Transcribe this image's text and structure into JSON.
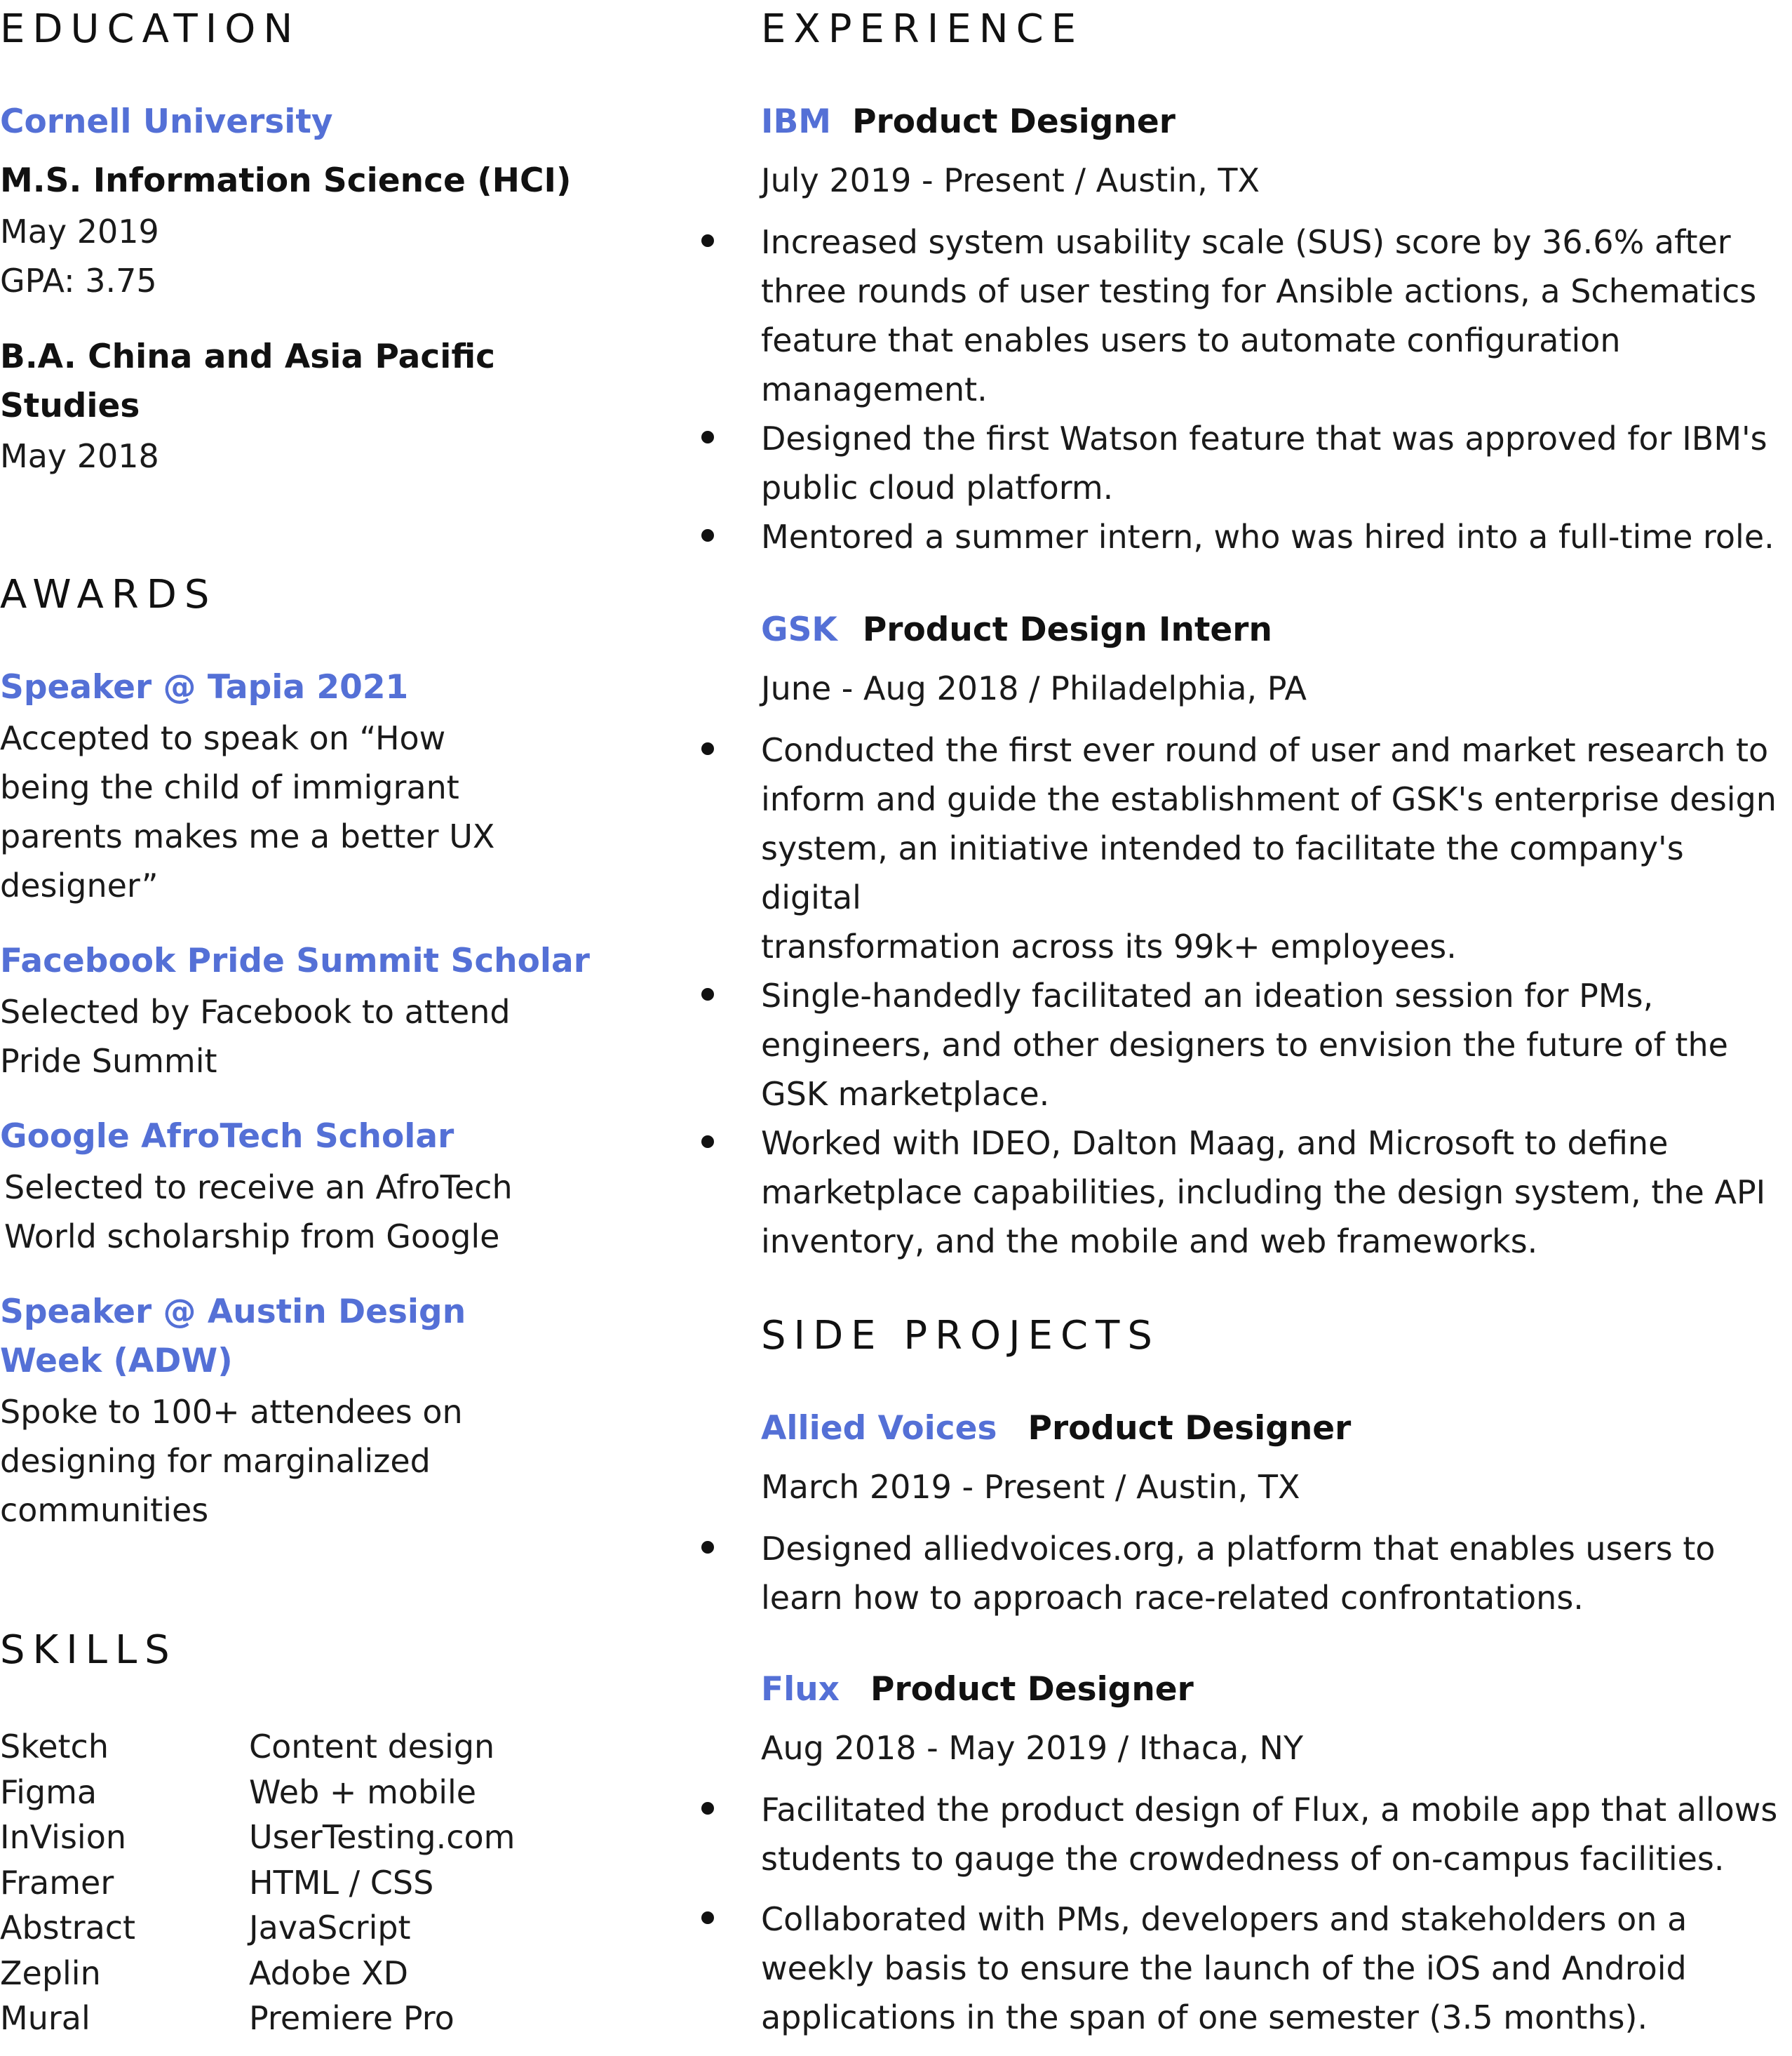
{
  "education": {
    "heading": "EDUCATION",
    "school": "Cornell University",
    "degrees": [
      {
        "title": "M.S. Information Science (HCI)",
        "lines": [
          "May 2019",
          "GPA: 3.75"
        ]
      },
      {
        "title_lines": [
          "B.A. China and Asia Pacific",
          "Studies"
        ],
        "lines": [
          "May 2018"
        ]
      }
    ]
  },
  "awards": {
    "heading": "AWARDS",
    "items": [
      {
        "title_lines": [
          "Speaker @ Tapia 2021"
        ],
        "desc_lines": [
          "Accepted to speak on “How",
          "being the child of immigrant",
          "parents makes me a better UX",
          "designer”"
        ]
      },
      {
        "title_lines": [
          "Facebook Pride Summit Scholar"
        ],
        "desc_lines": [
          "Selected by Facebook to attend",
          "Pride Summit"
        ]
      },
      {
        "title_lines": [
          "Google AfroTech Scholar"
        ],
        "desc_lines": [
          "Selected to receive an AfroTech",
          "World scholarship from Google"
        ]
      },
      {
        "title_lines": [
          "Speaker @ Austin Design",
          "Week (ADW)"
        ],
        "desc_lines": [
          "Spoke to 100+ attendees on",
          "designing for marginalized",
          "communities"
        ]
      }
    ]
  },
  "skills": {
    "heading": "SKILLS",
    "col1": [
      "Sketch",
      "Figma",
      "InVision",
      "Framer",
      "Abstract",
      "Zeplin",
      "Mural"
    ],
    "col2": [
      "Content design",
      "Web + mobile",
      "UserTesting.com",
      "HTML / CSS",
      "JavaScript",
      "Adobe XD",
      "Premiere Pro"
    ]
  },
  "experience": {
    "heading": "EXPERIENCE",
    "jobs": [
      {
        "company": "IBM",
        "role": "Product Designer",
        "meta": "July 2019 - Present / Austin, TX",
        "bullets": [
          [
            "Increased system usability scale (SUS) score by 36.6% after",
            "three rounds of user testing for Ansible actions, a Schematics",
            "feature that enables users to automate configuration",
            "management."
          ],
          [
            "Designed the first Watson feature that was approved for IBM's",
            "public cloud platform."
          ],
          [
            "Mentored a summer intern, who was hired into a full-time role."
          ]
        ]
      },
      {
        "company": "GSK",
        "role": "Product Design Intern",
        "meta": "June - Aug 2018 / Philadelphia, PA",
        "bullets": [
          [
            "Conducted the first ever round of user and market research to",
            "inform and guide the establishment of GSK's enterprise design",
            "system, an initiative intended to facilitate the company's digital",
            "transformation across its 99k+ employees."
          ],
          [
            "Single-handedly facilitated an ideation session for PMs,",
            "engineers, and other designers to envision the future of the",
            "GSK marketplace."
          ],
          [
            "Worked with IDEO, Dalton Maag, and Microsoft to define",
            "marketplace capabilities, including the design system, the API",
            "inventory, and the mobile and web frameworks."
          ]
        ]
      }
    ]
  },
  "side_projects": {
    "heading": "SIDE PROJECTS",
    "projects": [
      {
        "company": "Allied Voices",
        "role": "Product Designer",
        "meta": "March 2019 - Present / Austin, TX",
        "bullets": [
          [
            "Designed alliedvoices.org, a platform that enables users to",
            "learn how to approach race-related confrontations."
          ]
        ]
      },
      {
        "company": "Flux",
        "role": "Product Designer",
        "meta": "Aug 2018 - May 2019 / Ithaca, NY",
        "bullets": [
          [
            "Facilitated the product design of Flux, a mobile app that allows",
            "students to gauge the crowdedness of on-campus facilities."
          ],
          [
            "Collaborated with PMs, developers and stakeholders on a",
            "weekly basis to ensure the launch of the iOS and Android",
            "applications in the span of one semester (3.5 months)."
          ]
        ]
      }
    ]
  }
}
